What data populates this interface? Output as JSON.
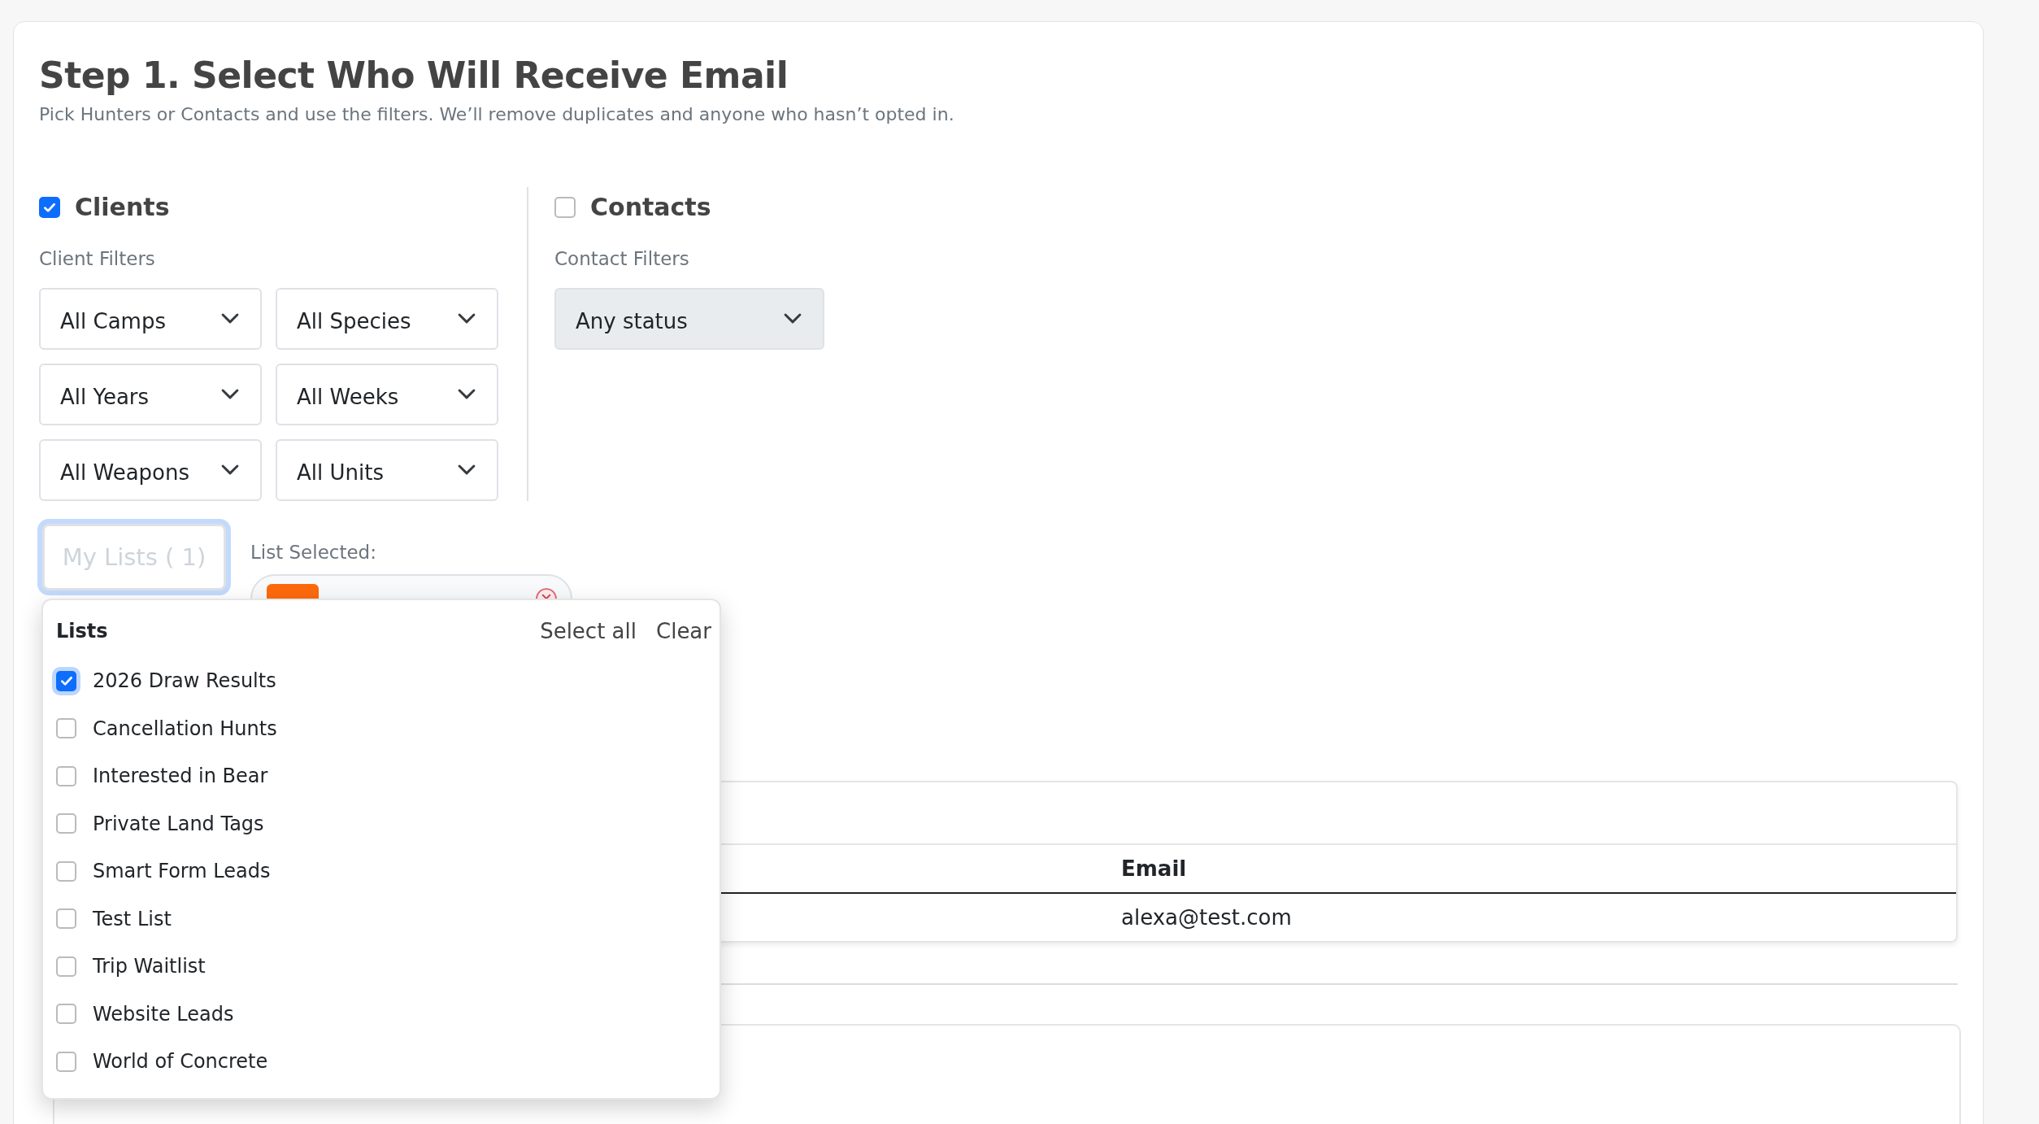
{
  "heading": {
    "title": "Step 1. Select Who Will Receive Email",
    "subtitle": "Pick Hunters or Contacts and use the filters. We’ll remove duplicates and anyone who hasn’t opted in."
  },
  "clients": {
    "label": "Clients",
    "checked": true,
    "filters_label": "Client Filters",
    "filters": [
      "All Camps",
      "All Species",
      "All Years",
      "All Weeks",
      "All Weapons",
      "All Units"
    ]
  },
  "contacts": {
    "label": "Contacts",
    "checked": false,
    "filters_label": "Contact Filters",
    "filters": [
      "Any status"
    ]
  },
  "my_lists": {
    "button": "My Lists ( 1)",
    "selected_label": "List Selected:"
  },
  "lists_menu": {
    "title": "Lists",
    "actions": [
      "Select all",
      "Clear"
    ],
    "items": [
      {
        "label": "2026 Draw Results",
        "checked": true
      },
      {
        "label": "Cancellation Hunts",
        "checked": false
      },
      {
        "label": "Interested in Bear",
        "checked": false
      },
      {
        "label": "Private Land Tags",
        "checked": false
      },
      {
        "label": "Smart Form Leads",
        "checked": false
      },
      {
        "label": "Test List",
        "checked": false
      },
      {
        "label": "Trip Waitlist",
        "checked": false
      },
      {
        "label": "Website Leads",
        "checked": false
      },
      {
        "label": "World of Concrete",
        "checked": false
      }
    ]
  },
  "table": {
    "columns": [
      "Email"
    ],
    "rows": [
      [
        "alexa@test.com"
      ]
    ]
  }
}
